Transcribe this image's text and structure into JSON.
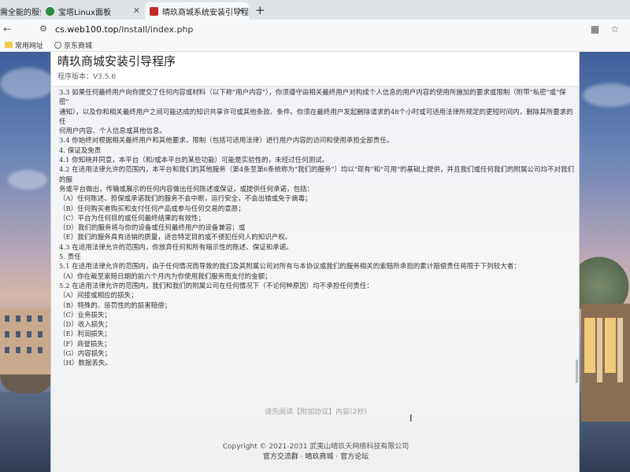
{
  "browser": {
    "tabs": [
      {
        "label": "需全能的服务",
        "active": false
      },
      {
        "label": "宝塔Linux面板",
        "active": false
      },
      {
        "label": "晴玖商城系统安装引导程序",
        "active": true
      }
    ],
    "new_tab": "+",
    "url_host": "cs.web100.top",
    "url_path": "/install/index.php",
    "bookmarks": [
      "常用网址",
      "京东商城"
    ]
  },
  "installer": {
    "title": "晴玖商城安装引导程序",
    "version": "程序版本：V3.5.6",
    "agreement_paragraphs": [
      "3.3 如果任何最终用户向你提交了任何内容或材料（以下称\"用户内容\"），你须遵守由相关最终用户对构成个人信息的用户内容的使用所施加的要求或限制（附带\"私密\"或\"保密\"",
      "通知），以及你和相关最终用户之间可能达成的知识共享许可或其他条款、条件。你须在最终用户发起删除请求的48个小时或可适用法律所规定的更短时间内，删除其所要求的任",
      "何用户内容、个人信息或其他信息。",
      "3.4 你始终对根据相关最终用户和其他要求，限制（包括可适用法律）进行用户内容的访问和使用承担全部责任。",
      "4. 保证及免责",
      "4.1 你知晓并同意，本平台（和/或本平台的某些功能）可能是实验性的，未经过任何测试。",
      "4.2 在适用法律允许的范围内，本平台和我们的其他服务（第4条至第6条统称为\"我们的服务\"）均以\"现有\"和\"可用\"的基础上提供，并且我们或任何我们的附属公司均不对我们的服",
      "务或平台做出，传输或展示的任何内容做出任何陈述或保证，或提供任何承诺，包括：",
      "（A）任何陈述、担保或承诺我们的服务不会中断，运行安全，不会出错或免于病毒；",
      "（B）任何购买者购买和支付任何产品或参与任何交易的意愿；",
      "（C）平台为任何目的或任何最终结果的有效性；",
      "（D）我们的服务将与你的设备或任何最终用户的设备兼容；或",
      "（E）我们的服务具有适销的质量，适合特定目的或不侵犯任何人的知识产权。",
      "4.3 在适用法律允许的范围内，你放弃任何和所有暗示性的陈述、保证和承诺。",
      "5. 责任",
      "5.1 在适用法律允许的范围内，由于任何情况而导致的我们及其附属公司对所有与本协议或我们的服务相关的索赔所承担的累计赔偿责任将限于下列较大者：",
      "（A）你在截至索赔日期的前六个月内为你使用我们服务而支付的金额；",
      "5.2 在适用法律允许的范围内，我们和我们的附属公司在任何情况下（不论何种原因）均不承担任何责任：",
      "（A）间接或相应的损失；",
      "（B）特殊的、惩罚性的的损害赔偿；",
      "（C）业务损失；",
      "（D）收入损失；",
      "（E）利润损失；",
      "（F）商誉损失；",
      "（G）内容损失；",
      "（H）数据丢失。"
    ],
    "agree_hint": "请先阅读【附加协议】内容(2秒)",
    "copyright": "Copyright © 2021-2031 武夷山晴玖天网络科技有限公司",
    "footer_links": [
      "官方交流群",
      "晴玖商城",
      "官方论坛"
    ],
    "footer_sep": " · "
  }
}
